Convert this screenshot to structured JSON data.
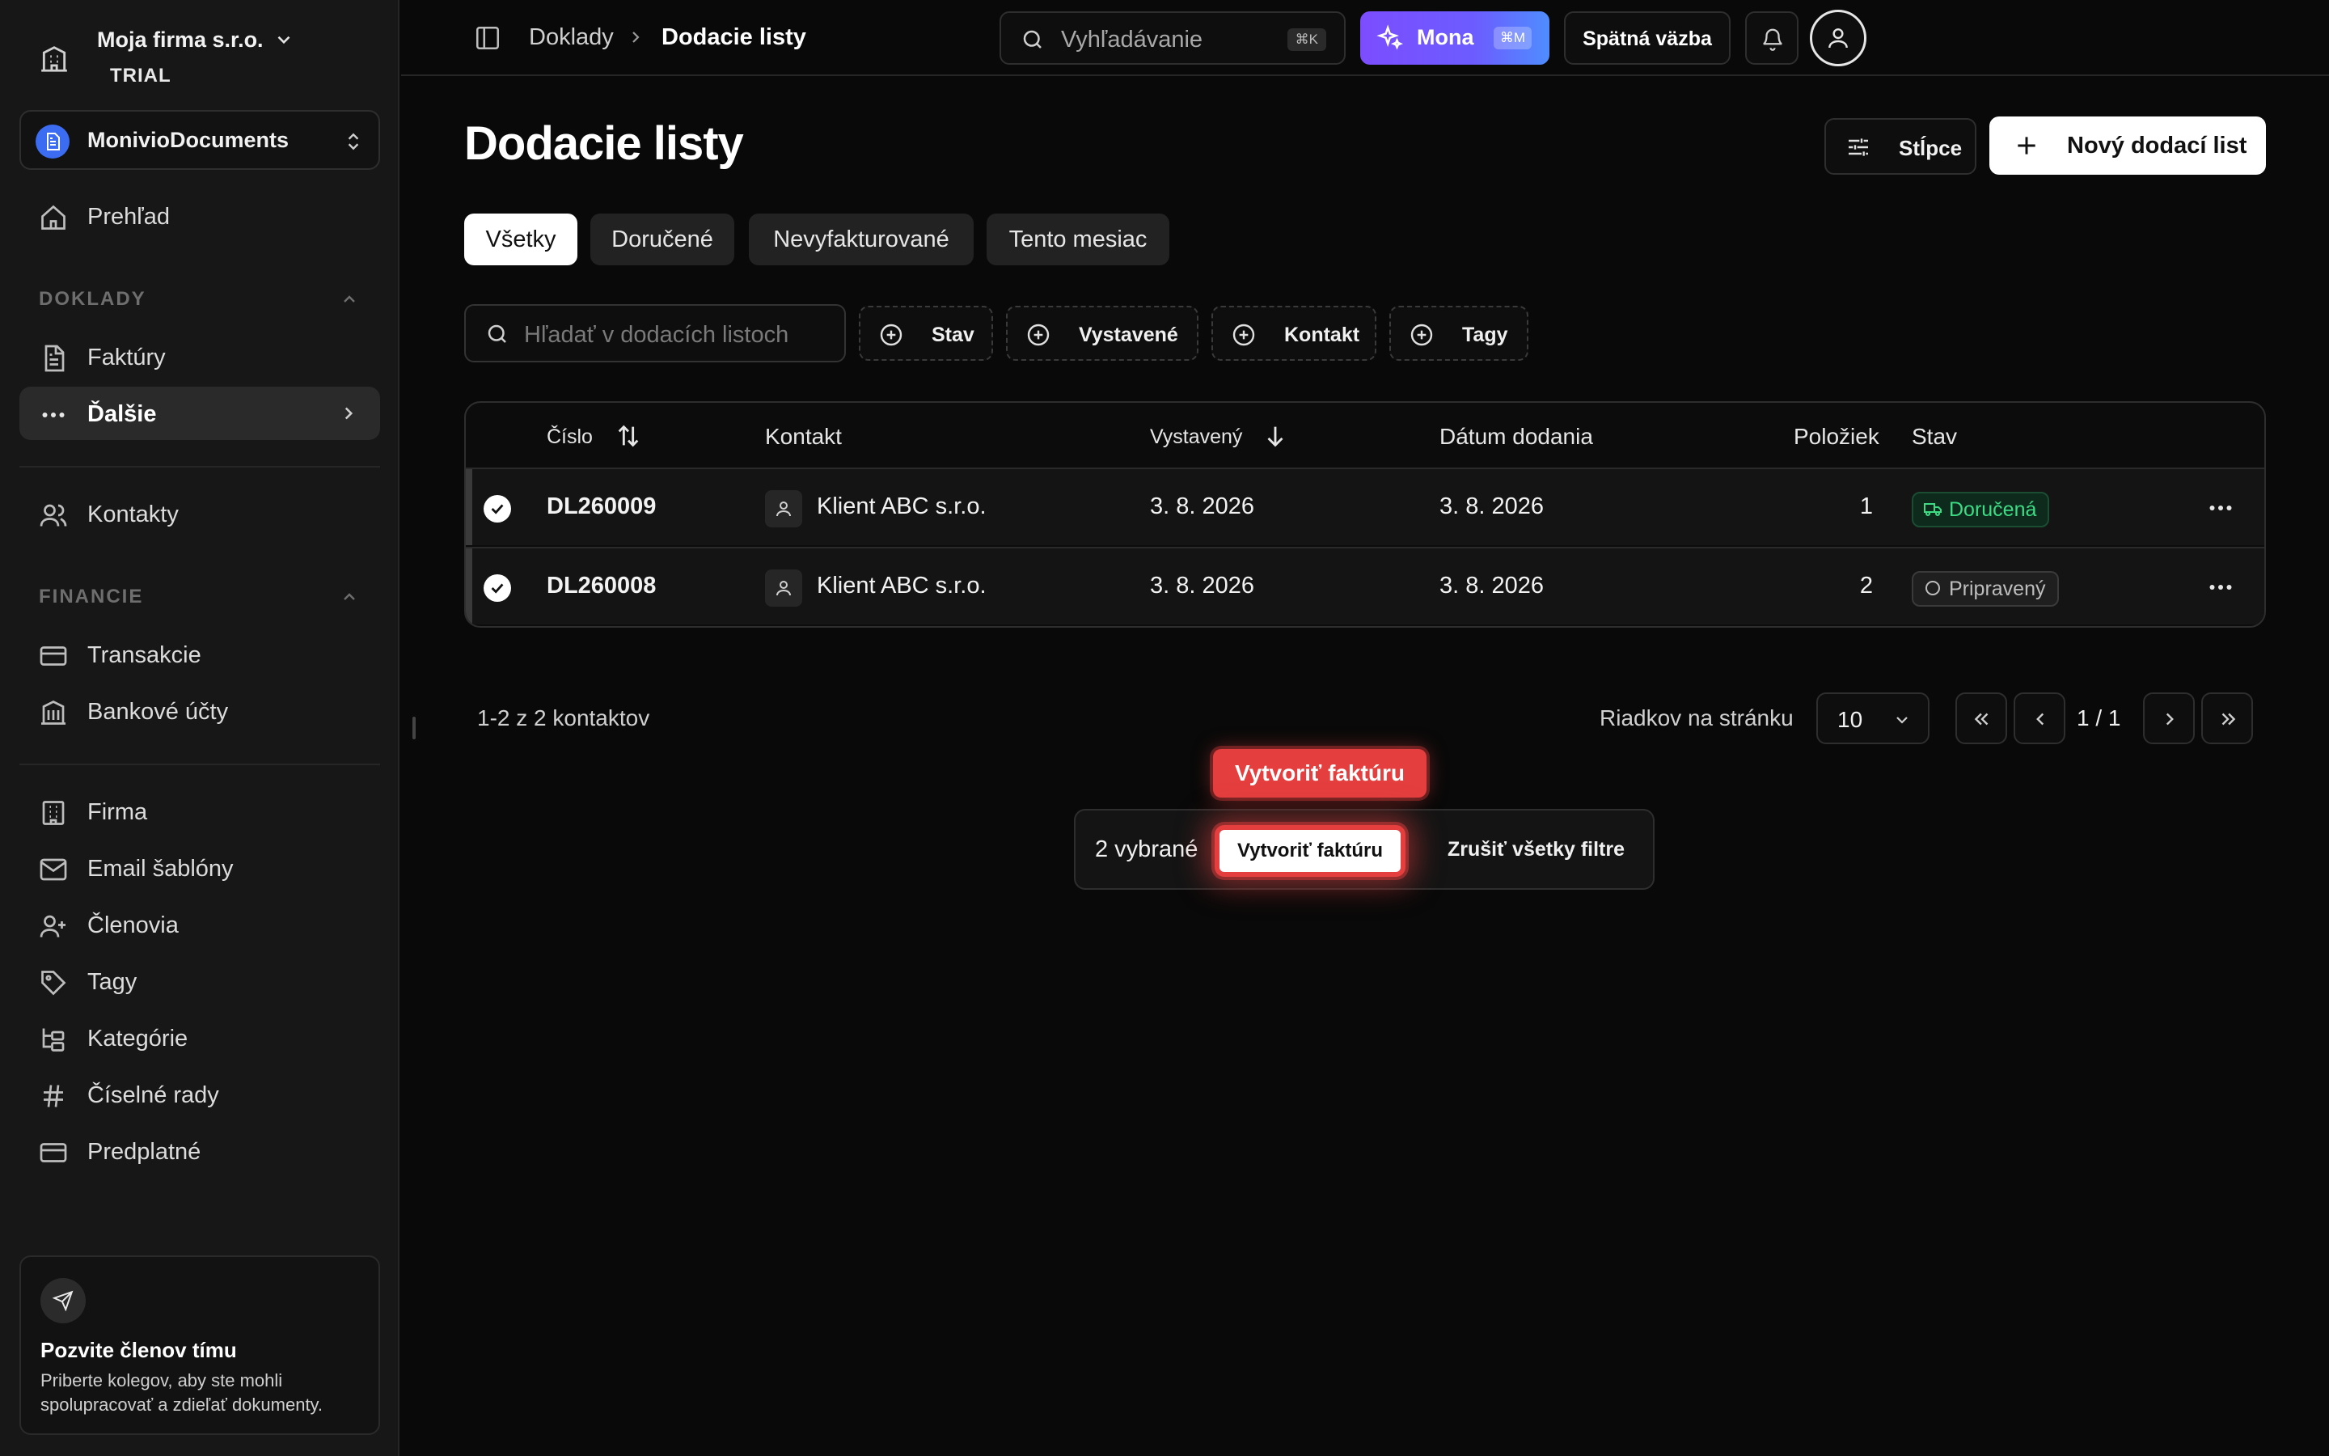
{
  "sidebar": {
    "company_name": "Moja firma s.r.o.",
    "plan_badge": "TRIAL",
    "workspace_name": "MonivioDocuments",
    "nav_overview": "Prehľad",
    "section_documents": "DOKLADY",
    "nav_invoices": "Faktúry",
    "nav_more": "Ďalšie",
    "nav_contacts": "Kontakty",
    "section_finance": "FINANCIE",
    "nav_transactions": "Transakcie",
    "nav_bank_accounts": "Bankové účty",
    "nav_company": "Firma",
    "nav_email_templates": "Email šablóny",
    "nav_members": "Členovia",
    "nav_tags": "Tagy",
    "nav_categories": "Kategórie",
    "nav_number_series": "Číselné rady",
    "nav_subscription": "Predplatné",
    "invite_title": "Pozvite členov tímu",
    "invite_desc": "Priberte kolegov, aby ste mohli spolupracovať a zdieľať dokumenty."
  },
  "topbar": {
    "breadcrumb_parent": "Doklady",
    "breadcrumb_current": "Dodacie listy",
    "search_placeholder": "Vyhľadávanie",
    "search_shortcut": "⌘K",
    "ai_label": "Mona",
    "ai_shortcut": "⌘M",
    "feedback_label": "Spätná väzba"
  },
  "main": {
    "title": "Dodacie listy",
    "columns_button": "Stĺpce",
    "new_button": "Nový dodací list",
    "tabs": [
      {
        "label": "Všetky"
      },
      {
        "label": "Doručené"
      },
      {
        "label": "Nevyfakturované"
      },
      {
        "label": "Tento mesiac"
      }
    ],
    "list_search_placeholder": "Hľadať v dodacích listoch",
    "filters": [
      {
        "label": "Stav"
      },
      {
        "label": "Vystavené"
      },
      {
        "label": "Kontakt"
      },
      {
        "label": "Tagy"
      }
    ],
    "table": {
      "headers": {
        "number": "Číslo",
        "contact": "Kontakt",
        "issued": "Vystavený",
        "delivery_date": "Dátum dodania",
        "items": "Položiek",
        "status": "Stav"
      },
      "rows": [
        {
          "number": "DL260009",
          "contact": "Klient ABC s.r.o.",
          "issued": "3. 8. 2026",
          "delivery_date": "3. 8. 2026",
          "items": "1",
          "status": "Doručená",
          "status_color": "#3ddc84"
        },
        {
          "number": "DL260008",
          "contact": "Klient ABC s.r.o.",
          "issued": "3. 8. 2026",
          "delivery_date": "3. 8. 2026",
          "items": "2",
          "status": "Pripravený",
          "status_color": "#bdbdbd"
        }
      ]
    },
    "results_text": "1-2 z 2 kontaktov",
    "rows_per_page_label": "Riadkov na stránku",
    "rows_per_page_value": "10",
    "page_indicator": "1 / 1"
  },
  "action_bar": {
    "selected_text": "2 vybrané",
    "create_invoice": "Vytvoriť faktúru",
    "clear_filters": "Zrušiť všetky filtre",
    "tooltip": "Vytvoriť faktúru"
  },
  "colors": {
    "accent_highlight": "#e53e3e",
    "ai_gradient_start": "#7c4dff",
    "ai_gradient_end": "#4f8dff",
    "workspace_icon": "#3b6cf2"
  }
}
